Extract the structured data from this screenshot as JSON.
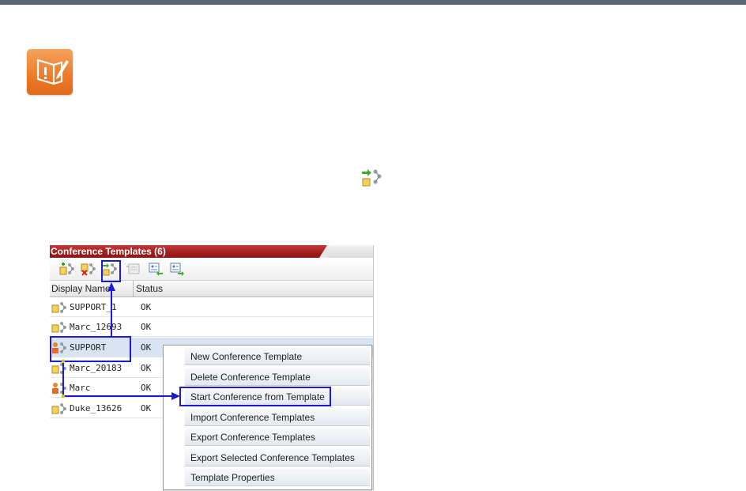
{
  "panel": {
    "title": "Conference Templates (6)",
    "columns": [
      "Display Name",
      "Status"
    ],
    "rows": [
      {
        "name": "SUPPORT_1",
        "status": "OK"
      },
      {
        "name": "Marc_12693",
        "status": "OK"
      },
      {
        "name": "SUPPORT",
        "status": "OK"
      },
      {
        "name": "Marc_20183",
        "status": "OK"
      },
      {
        "name": "Marc",
        "status": "OK"
      },
      {
        "name": "Duke_13626",
        "status": "OK"
      }
    ],
    "toolbar_icons": [
      "new-template-icon",
      "delete-template-icon",
      "start-conference-icon",
      "template-properties-icon",
      "import-templates-icon",
      "export-templates-icon"
    ]
  },
  "context_menu": {
    "items": [
      "New Conference Template",
      "Delete Conference Template",
      "Start Conference from Template",
      "Import Conference Templates",
      "Export Conference Templates",
      "Export Selected Conference Templates",
      "Template Properties"
    ]
  },
  "colors": {
    "title_red": "#a51f1f",
    "highlight_blue": "#1a1adb",
    "note_orange": "#ec7a2a",
    "selected_row": "#d9e4f2"
  }
}
